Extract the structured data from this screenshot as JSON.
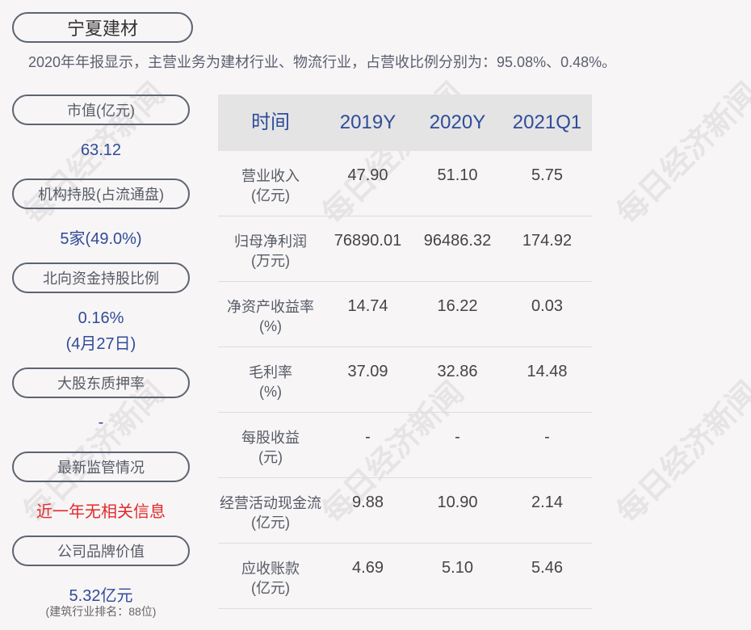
{
  "company": "宁夏建材",
  "summary": "2020年年报显示，主营业务为建材行业、物流行业，占营收比例分别为：95.08%、0.48%。",
  "watermark": "每日经济新闻",
  "left": {
    "market_cap_label": "市值(亿元)",
    "market_cap_value": "63.12",
    "inst_label": "机构持股(占流通盘)",
    "inst_value": "5家(49.0%)",
    "north_label": "北向资金持股比例",
    "north_value": "0.16%",
    "north_date": "(4月27日)",
    "pledge_label": "大股东质押率",
    "pledge_value": "-",
    "reg_label": "最新监管情况",
    "reg_value": "近一年无相关信息",
    "brand_label": "公司品牌价值",
    "brand_value": "5.32亿元",
    "brand_rank": "(建筑行业排名：88位)"
  },
  "table": {
    "headers": [
      "时间",
      "2019Y",
      "2020Y",
      "2021Q1"
    ],
    "rows": [
      {
        "l1": "营业收入",
        "l2": "(亿元)",
        "v": [
          "47.90",
          "51.10",
          "5.75"
        ]
      },
      {
        "l1": "归母净利润",
        "l2": "(万元)",
        "v": [
          "76890.01",
          "96486.32",
          "174.92"
        ]
      },
      {
        "l1": "净资产收益率",
        "l2": "(%)",
        "v": [
          "14.74",
          "16.22",
          "0.03"
        ]
      },
      {
        "l1": "毛利率",
        "l2": "(%)",
        "v": [
          "37.09",
          "32.86",
          "14.48"
        ]
      },
      {
        "l1": "每股收益",
        "l2": "(元)",
        "v": [
          "-",
          "-",
          "-"
        ]
      },
      {
        "l1": "经营活动现金流",
        "l2": "(亿元)",
        "v": [
          "9.88",
          "10.90",
          "2.14"
        ]
      },
      {
        "l1": "应收账款",
        "l2": "(亿元)",
        "v": [
          "4.69",
          "5.10",
          "5.46"
        ]
      }
    ]
  }
}
